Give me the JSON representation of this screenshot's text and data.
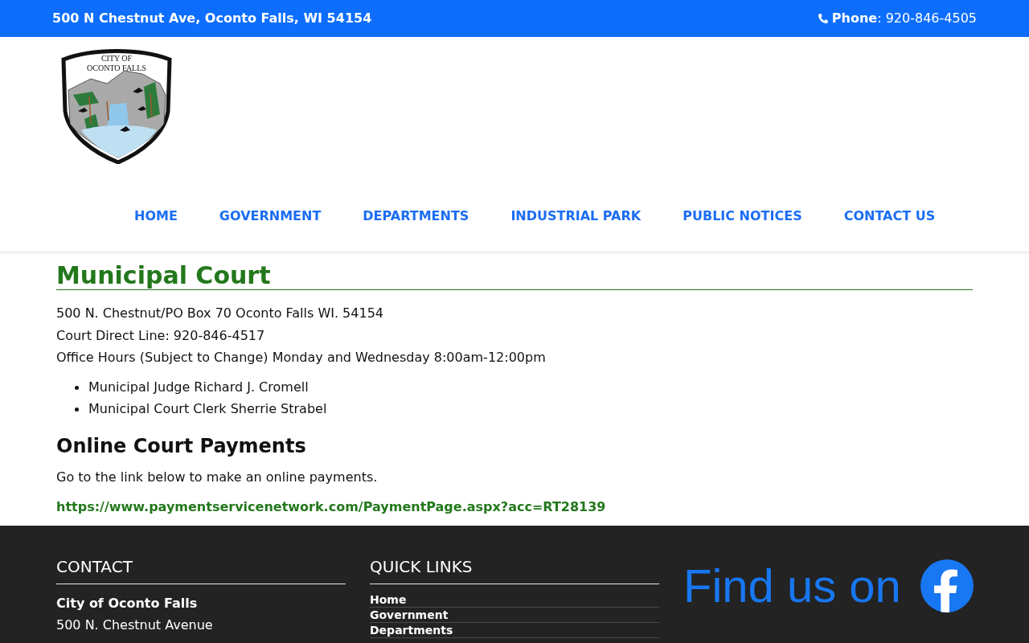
{
  "top_bar": {
    "address": "500 N Chestnut Ave, Oconto Falls, WI 54154",
    "phone": "**Phone**: 920-846-4505"
  },
  "header": {
    "logo": {
      "lines": [
        "CITY OF",
        "OCONTO FALLS"
      ]
    },
    "nav": [
      {
        "label": "HOME"
      },
      {
        "label": "GOVERNMENT"
      },
      {
        "label": "DEPARTMENTS"
      },
      {
        "label": "INDUSTRIAL PARK"
      },
      {
        "label": "PUBLIC NOTICES"
      },
      {
        "label": "CONTACT US"
      }
    ]
  },
  "main": {
    "title": "Municipal Court",
    "lines": [
      "500 N. Chestnut/PO Box 70 Oconto Falls WI. 54154",
      "Court Direct Line: 920-846-4517",
      "Office Hours (Subject to Change) Monday and Wednesday 8:00am-12:00pm"
    ],
    "people": [
      "Municipal Judge Richard J. Cromell",
      "Municipal Court Clerk Sherrie Strabel"
    ],
    "payments": {
      "heading": "Online Court Payments",
      "text": "Go to the link below to make an online payments.",
      "link": "https://www.paymentservicenetwork.com/PaymentPage.aspx?acc=RT28139"
    }
  },
  "footer": {
    "contact": {
      "heading": "CONTACT",
      "name": "City of Oconto Falls",
      "lines": [
        "500 N. Chestnut Avenue"
      ]
    },
    "quick_links": {
      "heading": "QUICK LINKS",
      "links": [
        "Home",
        "Government",
        "Departments"
      ]
    },
    "social": {
      "text": "Find us on"
    }
  }
}
